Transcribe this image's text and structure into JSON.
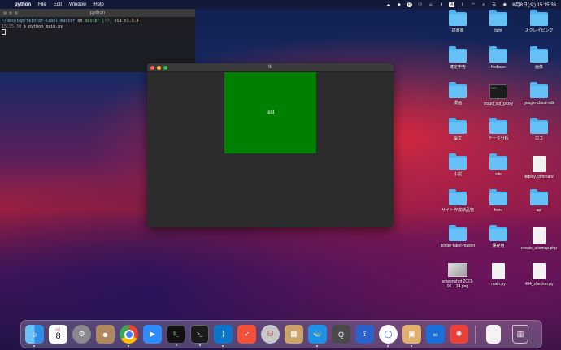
{
  "menubar": {
    "app": "python",
    "items": [
      "File",
      "Edit",
      "Window",
      "Help"
    ],
    "datetime": "6月8日(火) 15:15:36",
    "status_icons": [
      "cloud-icon",
      "dropbox-icon",
      "p-icon",
      "p-circle-icon",
      "cat-icon",
      "pause-icon",
      "a-icon",
      "bluetooth-icon",
      "wifi-icon",
      "search-icon",
      "control-center-icon",
      "siri-icon"
    ]
  },
  "terminal": {
    "title": "python",
    "line1_path": "~/desktop/tkinter-label-master",
    "line1_on": "on",
    "line1_branch": "master [!?]",
    "line1_via": "via",
    "line1_version": "v3.9.4",
    "line2_time": "15:15:30",
    "line2_prompt": "❯",
    "line2_cmd": "python main.py"
  },
  "tkwindow": {
    "title": "tk",
    "label_text": "test",
    "label_bg": "#008000"
  },
  "desktop": {
    "icons": [
      {
        "label": "読書書",
        "kind": "folder"
      },
      {
        "label": "light",
        "kind": "folder"
      },
      {
        "label": "スクレイピング",
        "kind": "folder"
      },
      {
        "label": "確定申告",
        "kind": "folder"
      },
      {
        "label": "firebase",
        "kind": "folder"
      },
      {
        "label": "画像",
        "kind": "folder"
      },
      {
        "label": "漫画",
        "kind": "folder"
      },
      {
        "label": "cloud_sql_proxy",
        "kind": "terminal"
      },
      {
        "label": "google-cloud-sdk",
        "kind": "folder"
      },
      {
        "label": "論文",
        "kind": "folder"
      },
      {
        "label": "データ分析",
        "kind": "folder"
      },
      {
        "label": "ロゴ",
        "kind": "folder"
      },
      {
        "label": "小説",
        "kind": "folder"
      },
      {
        "label": "site",
        "kind": "folder"
      },
      {
        "label": "deploy.command",
        "kind": "doc"
      },
      {
        "label": "サイト作成納品物",
        "kind": "folder"
      },
      {
        "label": "front",
        "kind": "folder"
      },
      {
        "label": "api",
        "kind": "folder"
      },
      {
        "label": "tkinter-label-master",
        "kind": "folder"
      },
      {
        "label": "保存用",
        "kind": "folder"
      },
      {
        "label": "create_sitemap.php",
        "kind": "doc"
      },
      {
        "label": "screenshot 2021-06....24.png",
        "kind": "shot"
      },
      {
        "label": "main.py",
        "kind": "doc"
      },
      {
        "label": "404_checker.py",
        "kind": "doc"
      }
    ]
  },
  "dock": {
    "calendar_month": "6月",
    "calendar_day": "8",
    "apps": [
      "finder-icon",
      "calendar-icon",
      "system-preferences-icon",
      "contacts-icon",
      "chrome-icon",
      "zoom-icon",
      "iterm-icon",
      "terminal-icon",
      "vscode-icon",
      "swift-playgrounds-icon",
      "sequel-pro-icon",
      "archive-utility-icon",
      "docker-icon",
      "quicktime-icon",
      "sourcetree-icon",
      "sketch-icon",
      "preview-icon",
      "infinity-icon",
      "clock-icon"
    ],
    "colors": {
      "finder": "#2f8ee8",
      "chrome": "#ffffff",
      "zoom": "#2d8cff",
      "vscode": "#0e74c9",
      "swift": "#f05138",
      "docker": "#1d91e6",
      "sourcetree": "#2a62c9",
      "clock": "#e8413a"
    }
  }
}
